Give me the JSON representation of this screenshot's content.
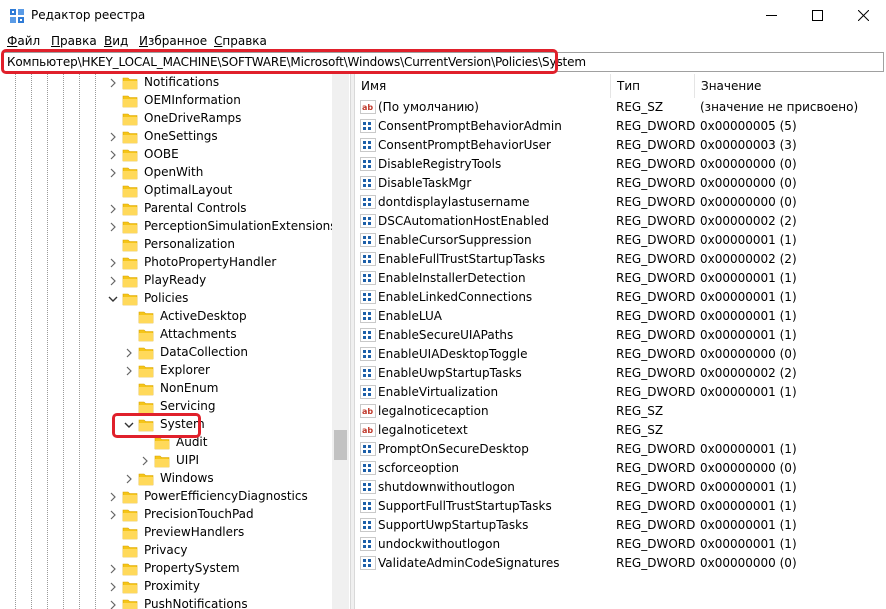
{
  "window": {
    "title": "Редактор реестра"
  },
  "menu": [
    {
      "u": "Ф",
      "rest": "айл"
    },
    {
      "u": "П",
      "rest": "равка"
    },
    {
      "u": "В",
      "rest": "ид"
    },
    {
      "u": "И",
      "rest": "збранное"
    },
    {
      "u": "С",
      "rest": "правка"
    }
  ],
  "address": {
    "path": "Компьютер\\HKEY_LOCAL_MACHINE\\SOFTWARE\\Microsoft\\Windows\\CurrentVersion\\Policies\\System"
  },
  "tree": [
    {
      "label": "Notifications",
      "level": 0,
      "expander": "right"
    },
    {
      "label": "OEMInformation",
      "level": 0,
      "expander": "none"
    },
    {
      "label": "OneDriveRamps",
      "level": 0,
      "expander": "none"
    },
    {
      "label": "OneSettings",
      "level": 0,
      "expander": "right"
    },
    {
      "label": "OOBE",
      "level": 0,
      "expander": "right"
    },
    {
      "label": "OpenWith",
      "level": 0,
      "expander": "right"
    },
    {
      "label": "OptimalLayout",
      "level": 0,
      "expander": "none"
    },
    {
      "label": "Parental Controls",
      "level": 0,
      "expander": "right"
    },
    {
      "label": "PerceptionSimulationExtensions",
      "level": 0,
      "expander": "right"
    },
    {
      "label": "Personalization",
      "level": 0,
      "expander": "none"
    },
    {
      "label": "PhotoPropertyHandler",
      "level": 0,
      "expander": "right"
    },
    {
      "label": "PlayReady",
      "level": 0,
      "expander": "right"
    },
    {
      "label": "Policies",
      "level": 0,
      "expander": "down"
    },
    {
      "label": "ActiveDesktop",
      "level": 1,
      "expander": "none"
    },
    {
      "label": "Attachments",
      "level": 1,
      "expander": "none"
    },
    {
      "label": "DataCollection",
      "level": 1,
      "expander": "right"
    },
    {
      "label": "Explorer",
      "level": 1,
      "expander": "right"
    },
    {
      "label": "NonEnum",
      "level": 1,
      "expander": "none"
    },
    {
      "label": "Servicing",
      "level": 1,
      "expander": "none"
    },
    {
      "label": "System",
      "level": 1,
      "expander": "down",
      "selected": true
    },
    {
      "label": "Audit",
      "level": 2,
      "expander": "none"
    },
    {
      "label": "UIPI",
      "level": 2,
      "expander": "right"
    },
    {
      "label": "Windows",
      "level": 1,
      "expander": "right"
    },
    {
      "label": "PowerEfficiencyDiagnostics",
      "level": 0,
      "expander": "right"
    },
    {
      "label": "PrecisionTouchPad",
      "level": 0,
      "expander": "right"
    },
    {
      "label": "PreviewHandlers",
      "level": 0,
      "expander": "none"
    },
    {
      "label": "Privacy",
      "level": 0,
      "expander": "none"
    },
    {
      "label": "PropertySystem",
      "level": 0,
      "expander": "right"
    },
    {
      "label": "Proximity",
      "level": 0,
      "expander": "right"
    },
    {
      "label": "PushNotifications",
      "level": 0,
      "expander": "right"
    }
  ],
  "list": {
    "headers": {
      "name": "Имя",
      "type": "Тип",
      "data": "Значение"
    },
    "rows": [
      {
        "icon": "string-value-icon",
        "name": "(По умолчанию)",
        "type": "REG_SZ",
        "data": "(значение не присвоено)"
      },
      {
        "icon": "binary-value-icon",
        "name": "ConsentPromptBehaviorAdmin",
        "type": "REG_DWORD",
        "data": "0x00000005 (5)"
      },
      {
        "icon": "binary-value-icon",
        "name": "ConsentPromptBehaviorUser",
        "type": "REG_DWORD",
        "data": "0x00000003 (3)"
      },
      {
        "icon": "binary-value-icon",
        "name": "DisableRegistryTools",
        "type": "REG_DWORD",
        "data": "0x00000000 (0)"
      },
      {
        "icon": "binary-value-icon",
        "name": "DisableTaskMgr",
        "type": "REG_DWORD",
        "data": "0x00000000 (0)"
      },
      {
        "icon": "binary-value-icon",
        "name": "dontdisplaylastusername",
        "type": "REG_DWORD",
        "data": "0x00000000 (0)"
      },
      {
        "icon": "binary-value-icon",
        "name": "DSCAutomationHostEnabled",
        "type": "REG_DWORD",
        "data": "0x00000002 (2)"
      },
      {
        "icon": "binary-value-icon",
        "name": "EnableCursorSuppression",
        "type": "REG_DWORD",
        "data": "0x00000001 (1)"
      },
      {
        "icon": "binary-value-icon",
        "name": "EnableFullTrustStartupTasks",
        "type": "REG_DWORD",
        "data": "0x00000002 (2)"
      },
      {
        "icon": "binary-value-icon",
        "name": "EnableInstallerDetection",
        "type": "REG_DWORD",
        "data": "0x00000001 (1)"
      },
      {
        "icon": "binary-value-icon",
        "name": "EnableLinkedConnections",
        "type": "REG_DWORD",
        "data": "0x00000001 (1)"
      },
      {
        "icon": "binary-value-icon",
        "name": "EnableLUA",
        "type": "REG_DWORD",
        "data": "0x00000001 (1)"
      },
      {
        "icon": "binary-value-icon",
        "name": "EnableSecureUIAPaths",
        "type": "REG_DWORD",
        "data": "0x00000001 (1)"
      },
      {
        "icon": "binary-value-icon",
        "name": "EnableUIADesktopToggle",
        "type": "REG_DWORD",
        "data": "0x00000000 (0)"
      },
      {
        "icon": "binary-value-icon",
        "name": "EnableUwpStartupTasks",
        "type": "REG_DWORD",
        "data": "0x00000002 (2)"
      },
      {
        "icon": "binary-value-icon",
        "name": "EnableVirtualization",
        "type": "REG_DWORD",
        "data": "0x00000001 (1)"
      },
      {
        "icon": "string-value-icon",
        "name": "legalnoticecaption",
        "type": "REG_SZ",
        "data": ""
      },
      {
        "icon": "string-value-icon",
        "name": "legalnoticetext",
        "type": "REG_SZ",
        "data": ""
      },
      {
        "icon": "binary-value-icon",
        "name": "PromptOnSecureDesktop",
        "type": "REG_DWORD",
        "data": "0x00000001 (1)"
      },
      {
        "icon": "binary-value-icon",
        "name": "scforceoption",
        "type": "REG_DWORD",
        "data": "0x00000000 (0)"
      },
      {
        "icon": "binary-value-icon",
        "name": "shutdownwithoutlogon",
        "type": "REG_DWORD",
        "data": "0x00000001 (1)"
      },
      {
        "icon": "binary-value-icon",
        "name": "SupportFullTrustStartupTasks",
        "type": "REG_DWORD",
        "data": "0x00000001 (1)"
      },
      {
        "icon": "binary-value-icon",
        "name": "SupportUwpStartupTasks",
        "type": "REG_DWORD",
        "data": "0x00000001 (1)"
      },
      {
        "icon": "binary-value-icon",
        "name": "undockwithoutlogon",
        "type": "REG_DWORD",
        "data": "0x00000001 (1)"
      },
      {
        "icon": "binary-value-icon",
        "name": "ValidateAdminCodeSignatures",
        "type": "REG_DWORD",
        "data": "0x00000000 (0)"
      }
    ]
  },
  "colors": {
    "highlight": "#e0202b",
    "folder": "#f5c518",
    "string_icon": "#c0392b",
    "binary_icon": "#1d5fa8"
  }
}
